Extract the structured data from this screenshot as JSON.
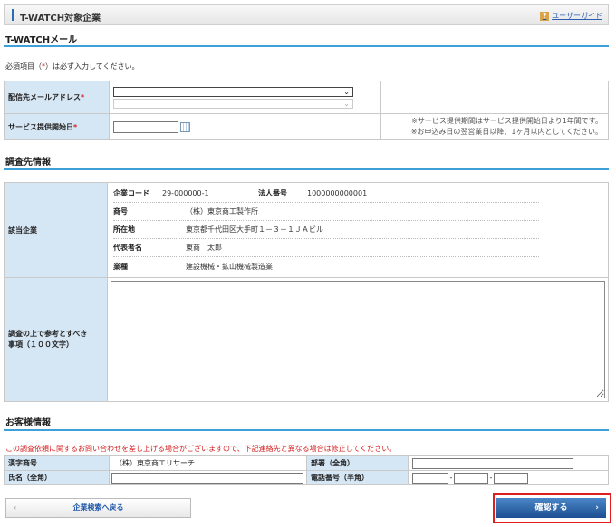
{
  "header": {
    "title": "T-WATCH対象企業",
    "guide_label": "ユーザーガイド",
    "guide_icon": "?"
  },
  "section_mail": {
    "title": "T-WATCHメール"
  },
  "required_note": {
    "pre": "必須項目（",
    "mark": "*",
    "post": "）は必ず入力してください。"
  },
  "form": {
    "delivery_label": "配信先メールアドレス",
    "start_date_label": "サービス提供開始日",
    "required_mark": "*",
    "service_note_1": "※サービス提供期間はサービス提供開始日より1年間です。",
    "service_note_2": "※お申込み日の翌営業日以降、1ヶ月以内としてください。"
  },
  "section_survey": {
    "title": "調査先情報"
  },
  "survey": {
    "target_label": "該当企業",
    "company_code_label": "企業コード",
    "company_code": "29-000000-1",
    "corp_no_label": "法人番号",
    "corp_no": "1000000000001",
    "rows": [
      {
        "label": "商号",
        "value": "（株）東京商工製作所"
      },
      {
        "label": "所在地",
        "value": "東京都千代田区大手町１－３－１ＪＡビル"
      },
      {
        "label": "代表者名",
        "value": "東商　太郎"
      },
      {
        "label": "業種",
        "value": "建設機械・鉱山機械製造業"
      }
    ],
    "memo_label_1": "調査の上で参考とすべき",
    "memo_label_2": "事項（１００文字）"
  },
  "section_customer": {
    "title": "お客様情報"
  },
  "customer": {
    "notice": "この調査依頼に関するお問い合わせを差し上げる場合がございますので、下記連絡先と異なる場合は修正してください。",
    "kanji_label": "漢字商号",
    "kanji_value": "（株）東京商エリサーチ",
    "dept_label": "部署（全角）",
    "name_label": "氏名（全角）",
    "phone_label": "電話番号（半角）",
    "phone_sep": "-"
  },
  "buttons": {
    "back": "企業検索へ戻る",
    "back_chev": "‹",
    "confirm": "確認する",
    "confirm_chev": "›"
  },
  "colors": {
    "accent": "#3ea0d8",
    "label_bg": "#d5e6f4",
    "required": "#d42020",
    "confirm": "#1d4f91"
  }
}
